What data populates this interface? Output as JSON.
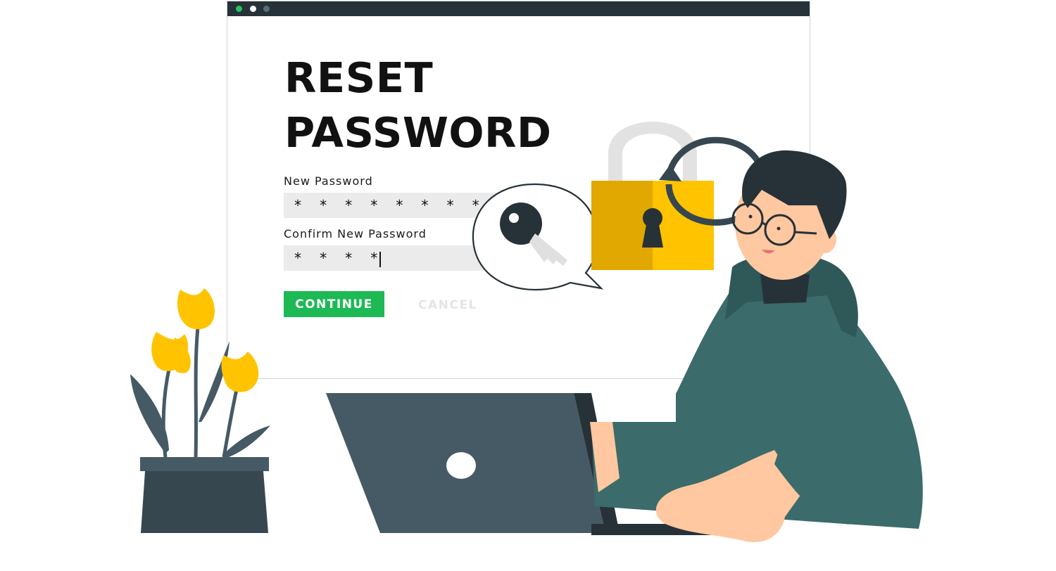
{
  "screen": {
    "title": "RESET\nPASSWORD",
    "new_password": {
      "label": "New Password",
      "value": "* * * * * * * *"
    },
    "confirm_password": {
      "label": "Confirm New Password",
      "value": "* * * *"
    },
    "buttons": {
      "continue": "CONTINUE",
      "cancel": "CANCEL"
    }
  },
  "colors": {
    "primary": "#1db954",
    "lock": "#ffc300",
    "hoodie": "#3b6b6b",
    "dark": "#263238",
    "skin": "#ffc8a0"
  },
  "icons": [
    "key-icon",
    "lock-icon",
    "refresh-arrow-icon"
  ]
}
